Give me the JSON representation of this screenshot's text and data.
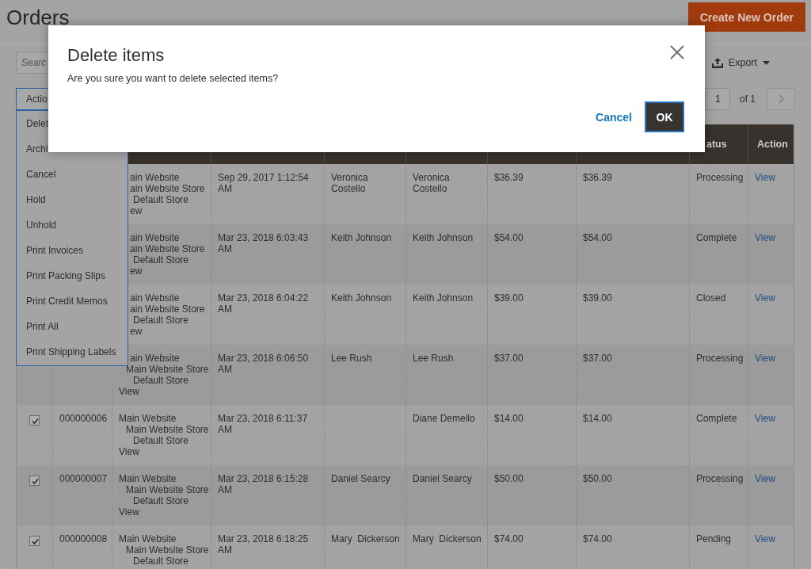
{
  "page": {
    "title": "Orders",
    "primary_button": "Create New Order"
  },
  "toolbar": {
    "search": {
      "placeholder": "Searc"
    },
    "export_label": "Export",
    "actions_label": "Actio",
    "pagination": {
      "page": "1",
      "of": "of 1"
    }
  },
  "actions_menu": {
    "items": [
      {
        "label": "Delet"
      },
      {
        "label": "Archi"
      },
      {
        "label": "Cancel"
      },
      {
        "label": "Hold"
      },
      {
        "label": "Unhold"
      },
      {
        "label": "Print Invoices"
      },
      {
        "label": "Print Packing Slips"
      },
      {
        "label": "Print Credit Memos"
      },
      {
        "label": "Print All"
      },
      {
        "label": "Print Shipping Labels"
      }
    ]
  },
  "table": {
    "header": {
      "column_9": "atus",
      "column_10": "Action"
    },
    "rows": [
      {
        "kind": "covered",
        "store_view": [
          "ain Website",
          "ain Website Store",
          "Default Store",
          "ew"
        ],
        "purchase_date": "Sep 29, 2017 1:12:54 AM",
        "bill_to": "Veronica Costello",
        "ship_to": "Veronica Costello",
        "grand_total_base": "$36.39",
        "grand_total_purchased": "$36.39",
        "status": "Processing",
        "action": "View"
      },
      {
        "kind": "covered",
        "store_view": [
          "ain Website",
          "ain Website Store",
          "Default Store",
          "ew"
        ],
        "purchase_date": "Mar 23, 2018 6:03:43 AM",
        "bill_to": "Keith Johnson",
        "ship_to": "Keith Johnson",
        "grand_total_base": "$54.00",
        "grand_total_purchased": "$54.00",
        "status": "Complete",
        "action": "View"
      },
      {
        "kind": "covered",
        "store_view": [
          "ain Website",
          "ain Website Store",
          "Default Store",
          "ew"
        ],
        "purchase_date": "Mar 23, 2018 6:04:22 AM",
        "bill_to": "Keith Johnson",
        "ship_to": "Keith Johnson",
        "grand_total_base": "$39.00",
        "grand_total_purchased": "$39.00",
        "status": "Closed",
        "action": "View"
      },
      {
        "kind": "top_covered",
        "store_view": [
          "ain Website",
          "Main Website Store",
          "Default Store",
          "View"
        ],
        "purchase_date": "Mar 23, 2018 6:06:50 AM",
        "bill_to": "Lee Rush",
        "ship_to": "Lee Rush",
        "grand_total_base": "$37.00",
        "grand_total_purchased": "$37.00",
        "status": "Processing",
        "action": "View"
      },
      {
        "kind": "plain",
        "checked": true,
        "id": "000000006",
        "store_view": [
          "Main Website",
          "Main Website Store",
          "Default Store",
          "View"
        ],
        "purchase_date": "Mar 23, 2018 6:11:37 AM",
        "ship_to": "Diane Demello",
        "grand_total_base": "$14.00",
        "grand_total_purchased": "$14.00",
        "status": "Complete",
        "action": "View"
      },
      {
        "kind": "plain",
        "checked": true,
        "id": "000000007",
        "store_view": [
          "Main Website",
          "Main Website Store",
          "Default Store",
          "View"
        ],
        "purchase_date": "Mar 23, 2018 6:15:28 AM",
        "bill_to": "Daniel Searcy",
        "ship_to": "Daniel Searcy",
        "grand_total_base": "$50.00",
        "grand_total_purchased": "$50.00",
        "status": "Processing",
        "action": "View"
      },
      {
        "kind": "plain",
        "checked": true,
        "id": "000000008",
        "store_view": [
          "Main Website",
          "Main Website Store",
          "Default Store"
        ],
        "purchase_date": "Mar 23, 2018 6:18:25 AM",
        "bill_to": "Mary  Dickerson",
        "ship_to": "Mary  Dickerson",
        "grand_total_base": "$74.00",
        "grand_total_purchased": "$74.00",
        "status": "Pending",
        "action": "View"
      }
    ]
  },
  "dialog": {
    "title": "Delete items",
    "message": "Are you sure you want to delete selected items?",
    "cancel": "Cancel",
    "ok": "OK",
    "ok_focused": true
  }
}
